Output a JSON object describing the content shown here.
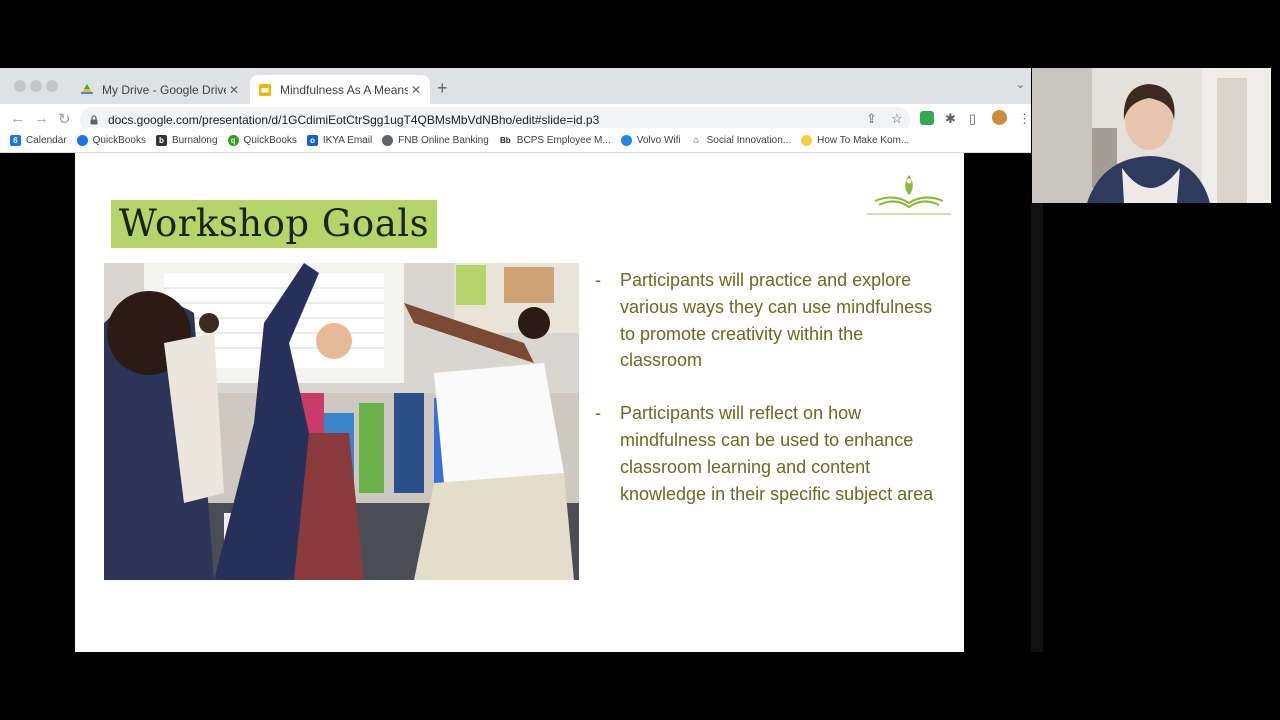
{
  "tabs": [
    {
      "title": "My Drive - Google Drive",
      "icon": "google-drive-icon"
    },
    {
      "title": "Mindfulness As A Means of Cr...",
      "icon": "google-slides-icon"
    }
  ],
  "address_bar": {
    "url": "docs.google.com/presentation/d/1GCdimiEotCtrSgg1ugT4QBMsMbVdNBho/edit#slide=id.p3"
  },
  "bookmarks": [
    {
      "label": "Calendar",
      "icon": "calendar-icon",
      "color": "#1a73e8"
    },
    {
      "label": "QuickBooks",
      "icon": "globe-icon",
      "color": "#1a73e8"
    },
    {
      "label": "Burnalong",
      "icon": "burnalong-icon",
      "color": "#333333"
    },
    {
      "label": "QuickBooks",
      "icon": "quickbooks-icon",
      "color": "#2ca01c"
    },
    {
      "label": "IKYA Email",
      "icon": "outlook-icon",
      "color": "#0a64c9"
    },
    {
      "label": "FNB Online Banking",
      "icon": "globe-icon",
      "color": "#5f6368"
    },
    {
      "label": "BCPS Employee M...",
      "icon": "blackboard-icon",
      "color": "#222222"
    },
    {
      "label": "Volvo Wifi",
      "icon": "wifi-icon",
      "color": "#1e88e5"
    },
    {
      "label": "Social Innovation...",
      "icon": "home-icon",
      "color": "#5f6368"
    },
    {
      "label": "How To Make Kom...",
      "icon": "yellow-circle-icon",
      "color": "#f4d03f"
    }
  ],
  "slide": {
    "title": "Workshop Goals",
    "bullets": [
      "Participants will practice and explore various ways they can use mindfulness to promote creativity within the classroom",
      "Participants will reflect on how mindfulness can be used to enhance classroom learning and content knowledge in their specific subject area"
    ],
    "accent_color": "#b5d56a",
    "text_color": "#6b6a22"
  }
}
